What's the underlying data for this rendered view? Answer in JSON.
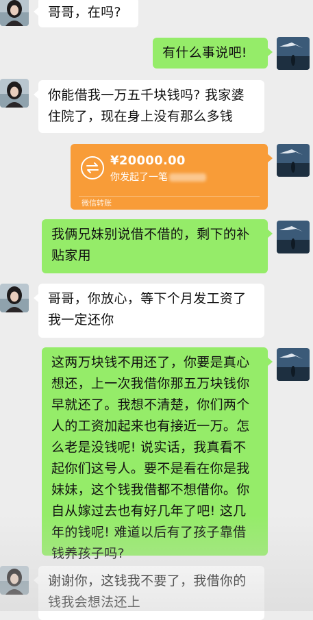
{
  "messages": [
    {
      "side": "in",
      "text": "哥哥，在吗?"
    },
    {
      "side": "out",
      "text": "有什么事说吧!"
    },
    {
      "side": "in",
      "text": "你能借我一万五千块钱吗? 我家婆住院了，现在身上没有那么多钱"
    },
    {
      "side": "out",
      "text": "我俩兄妹别说借不借的，剩下的补贴家用"
    },
    {
      "side": "in",
      "text": "哥哥，你放心，等下个月发工资了我一定还你"
    },
    {
      "side": "out",
      "text": "这两万块钱不用还了，你要是真心想还，上一次我借你那五万块钱你早就还了。我想不清楚，你们两个人的工资加起来也有接近一万。怎么老是没钱呢! 说实话，我真看不起你们这号人。要不是看在你是我妹妹，这个钱我借都不想借你。你自从嫁过去也有好几年了吧! 这几年的钱呢! 难道以后有了孩子靠借钱养孩子吗?"
    },
    {
      "side": "in",
      "text": "谢谢你，这钱我不要了，我借你的钱我会想法还上"
    }
  ],
  "transfer": {
    "amount": "¥20000.00",
    "description": "你发起了一笔",
    "footer": "微信转账",
    "icon": "transfer-arrows-icon"
  },
  "colors": {
    "background": "#ededed",
    "incoming_bubble": "#ffffff",
    "outgoing_bubble": "#95ec69",
    "transfer_card": "#f89c38"
  }
}
